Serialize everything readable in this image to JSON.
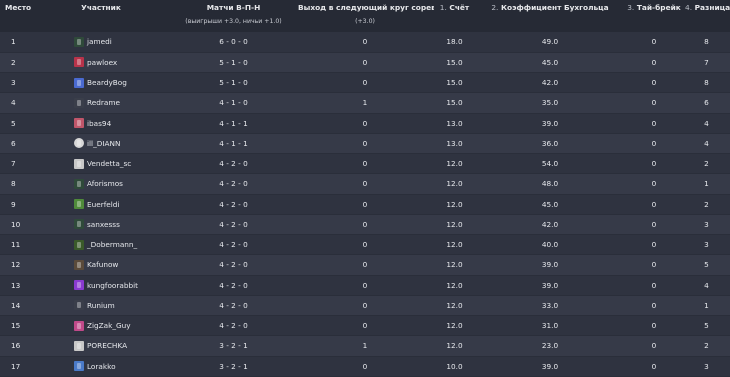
{
  "columns": {
    "rank": "Место",
    "player": "Участник",
    "matches": "Матчи В-П-Н",
    "matches_sub": "(выигрыши +3.0, ничьи +1.0)",
    "advance": "Выход в следующий круг соревнований",
    "advance_sub": "(+3.0)",
    "score_num": "1.",
    "score": "Счёт",
    "buchholz_num": "2.",
    "buchholz": "Коэффициент Бухгольца",
    "tiebreak_num": "3.",
    "tiebreak": "Тай-брейк",
    "diff_num": "4.",
    "diff": "Разница очков"
  },
  "rows": [
    {
      "rank": "1",
      "name": "jamedi",
      "avatar_color": "#2f4a3a",
      "avatar_icon": "avatar-icon",
      "record": "6 - 0 - 0",
      "advance": "0",
      "score": "18.0",
      "buchholz": "49.0",
      "tiebreak": "0",
      "diff": "8"
    },
    {
      "rank": "2",
      "name": "pawloex",
      "avatar_color": "#b8334a",
      "avatar_icon": "avatar-icon",
      "record": "5 - 1 - 0",
      "advance": "0",
      "score": "15.0",
      "buchholz": "45.0",
      "tiebreak": "0",
      "diff": "7"
    },
    {
      "rank": "3",
      "name": "BeardyBog",
      "avatar_color": "#4a6ad0",
      "avatar_icon": "avatar-icon",
      "record": "5 - 1 - 0",
      "advance": "0",
      "score": "15.0",
      "buchholz": "42.0",
      "tiebreak": "0",
      "diff": "8"
    },
    {
      "rank": "4",
      "name": "Redrame",
      "avatar_color": "#3a3e4a",
      "avatar_icon": "avatar-icon",
      "record": "4 - 1 - 0",
      "advance": "1",
      "score": "15.0",
      "buchholz": "35.0",
      "tiebreak": "0",
      "diff": "6"
    },
    {
      "rank": "5",
      "name": "ibas94",
      "avatar_color": "#c0566a",
      "avatar_icon": "avatar-icon",
      "record": "4 - 1 - 1",
      "advance": "0",
      "score": "13.0",
      "buchholz": "39.0",
      "tiebreak": "0",
      "diff": "4"
    },
    {
      "rank": "6",
      "name": "ill_DIANN",
      "avatar_color": "#d8d8d8",
      "avatar_icon": "skull-icon",
      "record": "4 - 1 - 1",
      "advance": "0",
      "score": "13.0",
      "buchholz": "36.0",
      "tiebreak": "0",
      "diff": "4"
    },
    {
      "rank": "7",
      "name": "Vendetta_sc",
      "avatar_color": "#c8c8c8",
      "avatar_icon": "avatar-icon",
      "record": "4 - 2 - 0",
      "advance": "0",
      "score": "12.0",
      "buchholz": "54.0",
      "tiebreak": "0",
      "diff": "2"
    },
    {
      "rank": "8",
      "name": "Aforismos",
      "avatar_color": "#2f4a3a",
      "avatar_icon": "avatar-icon",
      "record": "4 - 2 - 0",
      "advance": "0",
      "score": "12.0",
      "buchholz": "48.0",
      "tiebreak": "0",
      "diff": "1"
    },
    {
      "rank": "9",
      "name": "Euerfeldi",
      "avatar_color": "#4f8a3a",
      "avatar_icon": "avatar-icon",
      "record": "4 - 2 - 0",
      "advance": "0",
      "score": "12.0",
      "buchholz": "45.0",
      "tiebreak": "0",
      "diff": "2"
    },
    {
      "rank": "10",
      "name": "sanxesss",
      "avatar_color": "#2f4a3a",
      "avatar_icon": "avatar-icon",
      "record": "4 - 2 - 0",
      "advance": "0",
      "score": "12.0",
      "buchholz": "42.0",
      "tiebreak": "0",
      "diff": "3"
    },
    {
      "rank": "11",
      "name": "_Dobermann_",
      "avatar_color": "#3a5a2a",
      "avatar_icon": "avatar-icon",
      "record": "4 - 2 - 0",
      "advance": "0",
      "score": "12.0",
      "buchholz": "40.0",
      "tiebreak": "0",
      "diff": "3"
    },
    {
      "rank": "12",
      "name": "Kafunow",
      "avatar_color": "#5a4a3a",
      "avatar_icon": "avatar-icon",
      "record": "4 - 2 - 0",
      "advance": "0",
      "score": "12.0",
      "buchholz": "39.0",
      "tiebreak": "0",
      "diff": "5"
    },
    {
      "rank": "13",
      "name": "kungfoorabbit",
      "avatar_color": "#8a3ad0",
      "avatar_icon": "avatar-icon",
      "record": "4 - 2 - 0",
      "advance": "0",
      "score": "12.0",
      "buchholz": "39.0",
      "tiebreak": "0",
      "diff": "4"
    },
    {
      "rank": "14",
      "name": "Runium",
      "avatar_color": "#3a3e4a",
      "avatar_icon": "avatar-icon",
      "record": "4 - 2 - 0",
      "advance": "0",
      "score": "12.0",
      "buchholz": "33.0",
      "tiebreak": "0",
      "diff": "1"
    },
    {
      "rank": "15",
      "name": "ZigZak_Guy",
      "avatar_color": "#c04a8a",
      "avatar_icon": "avatar-icon",
      "record": "4 - 2 - 0",
      "advance": "0",
      "score": "12.0",
      "buchholz": "31.0",
      "tiebreak": "0",
      "diff": "5"
    },
    {
      "rank": "16",
      "name": "PORECHKA",
      "avatar_color": "#c8c8c8",
      "avatar_icon": "avatar-icon",
      "record": "3 - 2 - 1",
      "advance": "1",
      "score": "12.0",
      "buchholz": "23.0",
      "tiebreak": "0",
      "diff": "2"
    },
    {
      "rank": "17",
      "name": "Lorakko",
      "avatar_color": "#4a7ac8",
      "avatar_icon": "avatar-icon",
      "record": "3 - 2 - 1",
      "advance": "0",
      "score": "10.0",
      "buchholz": "39.0",
      "tiebreak": "0",
      "diff": "3"
    }
  ]
}
